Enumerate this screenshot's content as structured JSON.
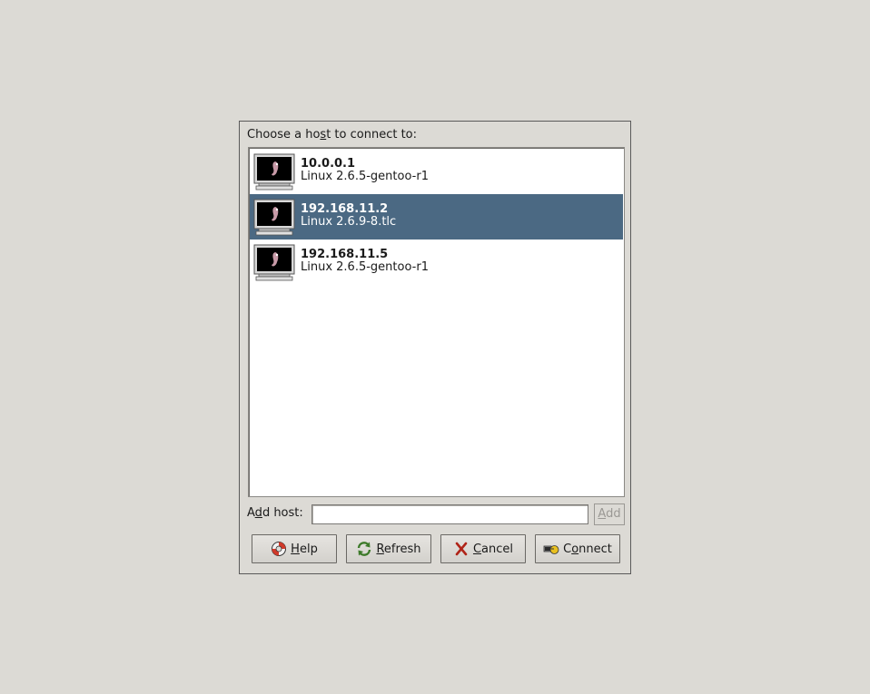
{
  "dialog": {
    "prompt_pre": "Choose a ho",
    "prompt_u": "s",
    "prompt_post": "t to connect to:"
  },
  "hosts": [
    {
      "ip": "10.0.0.1",
      "os": "Linux 2.6.5-gentoo-r1",
      "selected": false
    },
    {
      "ip": "192.168.11.2",
      "os": "Linux 2.6.9-8.tlc",
      "selected": true
    },
    {
      "ip": "192.168.11.5",
      "os": "Linux 2.6.5-gentoo-r1",
      "selected": false
    }
  ],
  "add_host": {
    "label_pre": "A",
    "label_u": "d",
    "label_post": "d host:",
    "value": "",
    "button_u": "A",
    "button_post": "dd"
  },
  "buttons": {
    "help": {
      "u": "H",
      "rest": "elp",
      "icon": "lifebuoy-icon"
    },
    "refresh": {
      "u": "R",
      "rest": "efresh",
      "icon": "refresh-icon"
    },
    "cancel": {
      "u": "C",
      "rest": "ancel",
      "icon": "cancel-x-icon"
    },
    "connect": {
      "pre": "C",
      "u": "o",
      "rest": "nnect",
      "icon": "connect-icon"
    }
  },
  "colors": {
    "selection": "#4b6983",
    "background": "#dcdad5"
  }
}
